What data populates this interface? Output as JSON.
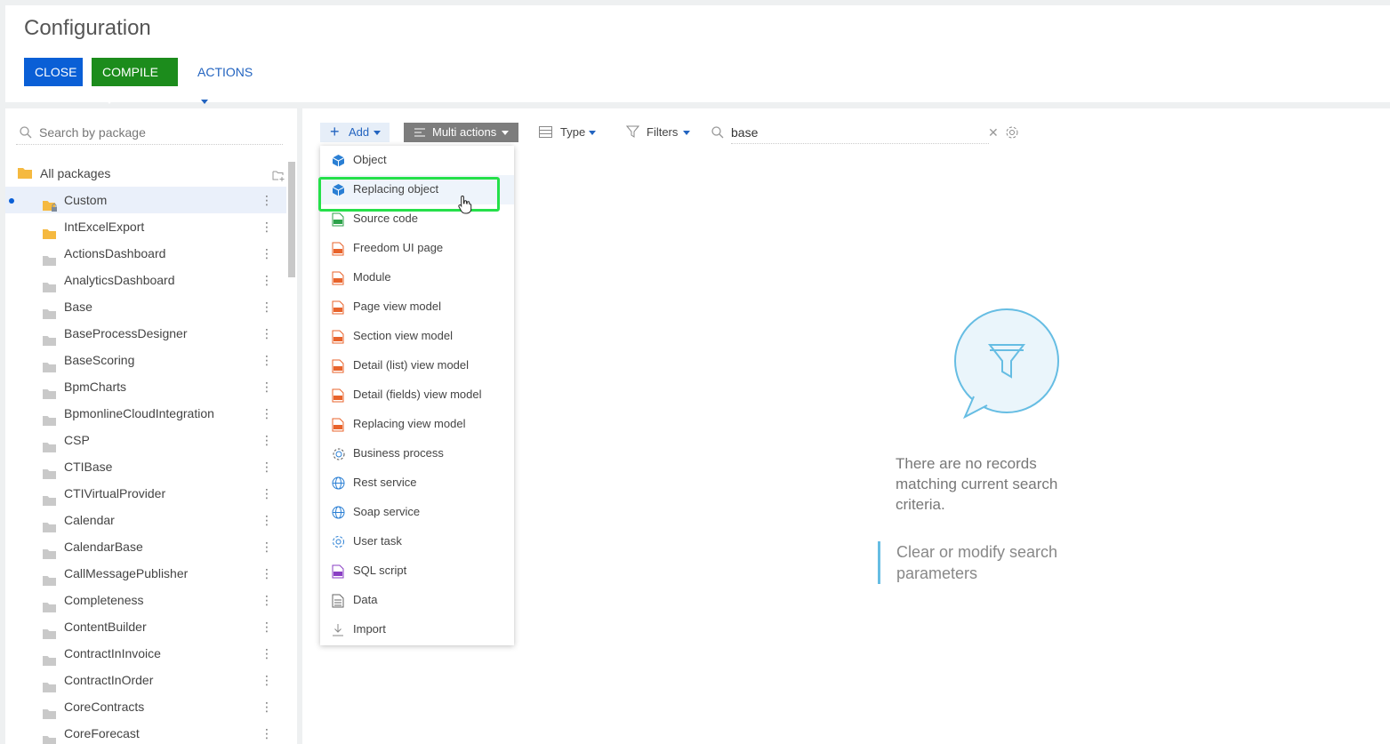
{
  "header": {
    "title": "Configuration",
    "close_label": "CLOSE",
    "compile_label": "COMPILE",
    "actions_label": "ACTIONS"
  },
  "sidebar": {
    "search_placeholder": "Search by package",
    "all_packages_label": "All packages",
    "packages": [
      {
        "label": "Custom",
        "icon": "locked-folder-icon",
        "selected": true
      },
      {
        "label": "IntExcelExport",
        "icon": "folder-icon"
      },
      {
        "label": "ActionsDashboard",
        "icon": "folder-icon"
      },
      {
        "label": "AnalyticsDashboard",
        "icon": "folder-icon"
      },
      {
        "label": "Base",
        "icon": "folder-icon"
      },
      {
        "label": "BaseProcessDesigner",
        "icon": "folder-icon"
      },
      {
        "label": "BaseScoring",
        "icon": "folder-icon"
      },
      {
        "label": "BpmCharts",
        "icon": "folder-icon"
      },
      {
        "label": "BpmonlineCloudIntegration",
        "icon": "folder-icon"
      },
      {
        "label": "CSP",
        "icon": "folder-icon"
      },
      {
        "label": "CTIBase",
        "icon": "folder-icon"
      },
      {
        "label": "CTIVirtualProvider",
        "icon": "folder-icon"
      },
      {
        "label": "Calendar",
        "icon": "folder-icon"
      },
      {
        "label": "CalendarBase",
        "icon": "folder-icon"
      },
      {
        "label": "CallMessagePublisher",
        "icon": "folder-icon"
      },
      {
        "label": "Completeness",
        "icon": "folder-icon"
      },
      {
        "label": "ContentBuilder",
        "icon": "folder-icon"
      },
      {
        "label": "ContractInInvoice",
        "icon": "folder-icon"
      },
      {
        "label": "ContractInOrder",
        "icon": "folder-icon"
      },
      {
        "label": "CoreContracts",
        "icon": "folder-icon"
      },
      {
        "label": "CoreForecast",
        "icon": "folder-icon"
      }
    ]
  },
  "toolbar": {
    "add_label": "Add",
    "multi_actions_label": "Multi actions",
    "type_label": "Type",
    "filters_label": "Filters",
    "search_value": "base"
  },
  "add_menu": {
    "items": [
      {
        "label": "Object",
        "icon": "object-cube-icon"
      },
      {
        "label": "Replacing object",
        "icon": "object-cube-icon",
        "hovered": true
      },
      {
        "label": "Source code",
        "icon": "source-code-icon"
      },
      {
        "label": "Freedom UI page",
        "icon": "js-file-icon"
      },
      {
        "label": "Module",
        "icon": "js-file-icon"
      },
      {
        "label": "Page view model",
        "icon": "js-file-icon"
      },
      {
        "label": "Section view model",
        "icon": "js-file-icon"
      },
      {
        "label": "Detail (list) view model",
        "icon": "js-file-icon"
      },
      {
        "label": "Detail (fields) view model",
        "icon": "js-file-icon"
      },
      {
        "label": "Replacing view model",
        "icon": "js-file-icon"
      },
      {
        "label": "Business process",
        "icon": "business-process-icon"
      },
      {
        "label": "Rest service",
        "icon": "globe-icon"
      },
      {
        "label": "Soap service",
        "icon": "globe-icon"
      },
      {
        "label": "User task",
        "icon": "gear-icon"
      },
      {
        "label": "SQL script",
        "icon": "sql-file-icon"
      },
      {
        "label": "Data",
        "icon": "data-file-icon"
      },
      {
        "label": "Import",
        "icon": "import-icon"
      }
    ]
  },
  "empty_state": {
    "message": "There are no records matching current search criteria.",
    "link": "Clear or modify search parameters"
  },
  "colors": {
    "close": "#0a5fd6",
    "compile": "#1c8c1c",
    "accent": "#2364c0",
    "highlight": "#25e04a"
  }
}
